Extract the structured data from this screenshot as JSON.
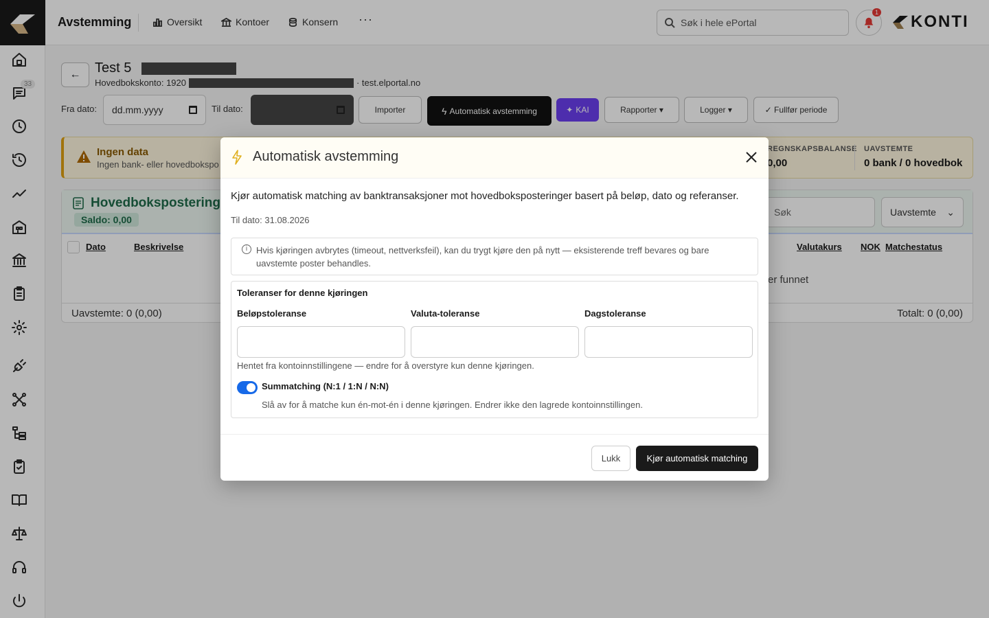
{
  "header": {
    "app_title": "Avstemming",
    "nav": [
      {
        "label": "Oversikt",
        "icon": "bar-chart-icon"
      },
      {
        "label": "Kontoer",
        "icon": "bank-icon"
      },
      {
        "label": "Konsern",
        "icon": "coins-icon"
      }
    ],
    "more": "···",
    "search_placeholder": "Søk i hele ePortal",
    "notification_count": "1",
    "brand": "KONTI"
  },
  "sidebar": {
    "badge": "33",
    "items": [
      "home-icon",
      "chat-icon",
      "clock-icon",
      "history-icon",
      "trend-icon",
      "building-icon",
      "bank-icon",
      "clipboard-icon",
      "gear-icon",
      "plug-icon",
      "network-icon",
      "tree-icon",
      "clipboard-check-icon",
      "book-icon",
      "scale-icon",
      "headset-icon",
      "power-icon"
    ]
  },
  "page": {
    "back": "←",
    "title": "Test 5",
    "account_prefix": "Hovedbokskonto: 1920",
    "account_suffix": "· test.elportal.no",
    "from_label": "Fra dato:",
    "from_placeholder": "dd.mm.yyyy",
    "to_label": "Til dato:",
    "buttons": {
      "import": "Importer",
      "auto": "Automatisk avstemming",
      "kai": "KAI",
      "reports": "Rapporter ▾",
      "logs": "Logger ▾",
      "finish": "✓ Fullfør periode"
    }
  },
  "alert": {
    "title": "Ingen data",
    "text": "Ingen bank- eller hovedbokspo",
    "stats": [
      {
        "label": "REGNSKAPSBALANSE",
        "value": "0,00"
      },
      {
        "label": "UAVSTEMTE",
        "value": "0 bank / 0 hovedbok"
      }
    ]
  },
  "panel": {
    "title": "Hovedbokspostering",
    "saldo": "Saldo: 0,00",
    "search_placeholder": "Søk",
    "filter": "Uavstemte",
    "columns": [
      "Dato",
      "Beskrivelse",
      "Valutakurs",
      "NOK",
      "Matchestatus"
    ],
    "empty": "er funnet",
    "footer_left": "Uavstemte: 0 (0,00)",
    "footer_right": "Totalt: 0 (0,00)"
  },
  "modal": {
    "title": "Automatisk avstemming",
    "description": "Kjør automatisk matching av banktransaksjoner mot hovedboksposteringer basert på beløp, dato og referanser.",
    "date": "Til dato: 31.08.2026",
    "info": "Hvis kjøringen avbrytes (timeout, nettverksfeil), kan du trygt kjøre den på nytt — eksisterende treff bevares og bare uavstemte poster behandles.",
    "tolerances_title": "Toleranser for denne kjøringen",
    "amount_label": "Beløpstoleranse",
    "currency_label": "Valuta-toleranse",
    "day_label": "Dagstoleranse",
    "amount_value": "",
    "currency_value": "",
    "day_value": "",
    "hint": "Hentet fra kontoinnstillingene — endre for å overstyre kun denne kjøringen.",
    "toggle_label": "Summatching (N:1 / 1:N / N:N)",
    "toggle_on": true,
    "toggle_hint": "Slå av for å matche kun én-mot-én i denne kjøringen. Endrer ikke den lagrede kontoinnstillingen.",
    "close_button": "Lukk",
    "run_button": "Kjør automatisk matching"
  },
  "colors": {
    "accent": "#1669e8",
    "kai": "#6b3ff0",
    "warning": "#e0a010",
    "green": "#1f6b4a"
  }
}
